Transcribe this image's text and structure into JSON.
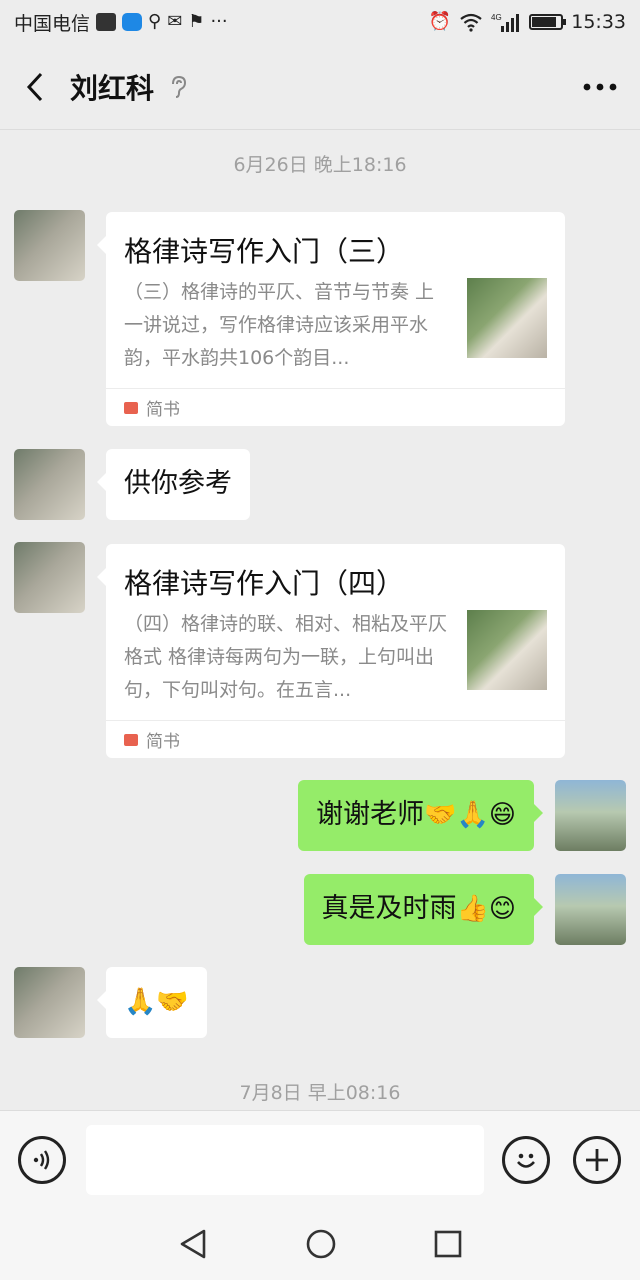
{
  "status_bar": {
    "carrier": "中国电信",
    "time": "15:33",
    "network": "4G"
  },
  "header": {
    "title": "刘红科"
  },
  "messages": {
    "time1": "6月26日 晚上18:16",
    "card1": {
      "title": "格律诗写作入门（三）",
      "desc": "（三）格律诗的平仄、音节与节奏 上一讲说过，写作格律诗应该采用平水韵，平水韵共106个韵目...",
      "source": "简书"
    },
    "text1": "供你参考",
    "card2": {
      "title": "格律诗写作入门（四）",
      "desc": "（四）格律诗的联、相对、相粘及平仄格式 格律诗每两句为一联，上句叫出句，下句叫对句。在五言...",
      "source": "简书"
    },
    "reply1_text": "谢谢老师",
    "reply1_emoji": "🤝🙏😄",
    "reply2_text": "真是及时雨",
    "reply2_emoji": "👍😊",
    "text2_emoji": "🙏🤝",
    "time2": "7月8日 早上08:16"
  },
  "colors": {
    "background": "#ededed",
    "sent_bubble": "#95ec69",
    "received_bubble": "#ffffff"
  }
}
